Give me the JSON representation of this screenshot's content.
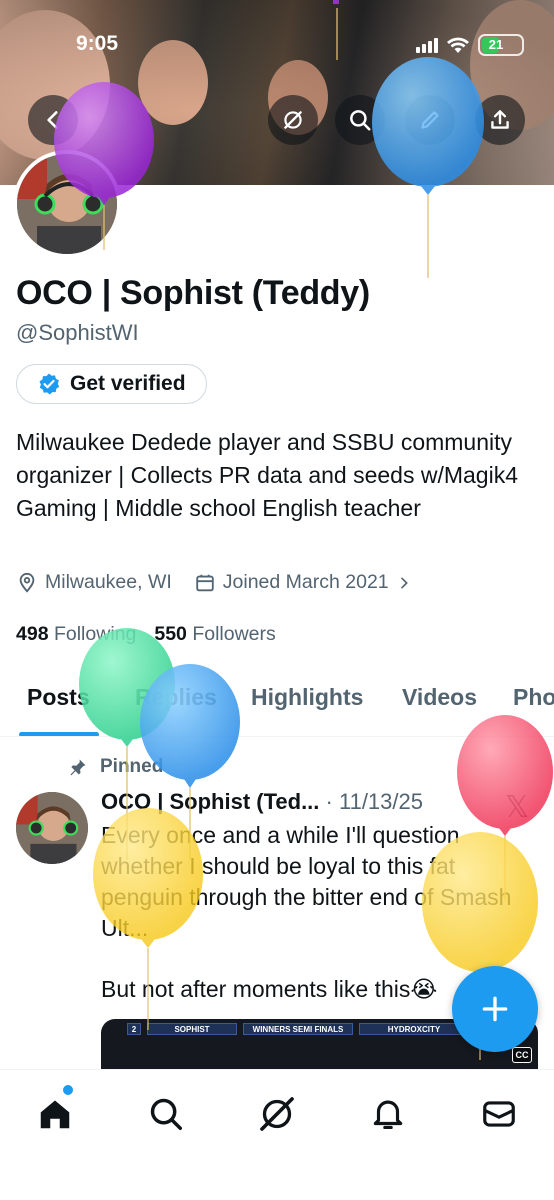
{
  "status_bar": {
    "time": "9:05",
    "battery": "21"
  },
  "header": {
    "back_icon": "back-arrow-icon",
    "grok_icon": "grok-icon",
    "search_icon": "search-icon",
    "edit_icon": "edit-pencil-icon",
    "share_icon": "share-upload-icon"
  },
  "profile": {
    "display_name": "OCO | Sophist (Teddy)",
    "handle": "@SophistWI",
    "verify_label": "Get verified",
    "bio": "Milwaukee Dedede player and SSBU community organizer | Collects PR data and seeds w/Magik4 Gaming | Middle school English teacher",
    "location": "Milwaukee, WI",
    "joined": "Joined March 2021",
    "following_count": "498",
    "following_label": "Following",
    "followers_count": "550",
    "followers_label": "Followers"
  },
  "tabs": [
    "Posts",
    "Replies",
    "Highlights",
    "Videos",
    "Photos"
  ],
  "post": {
    "pinned_label": "Pinned",
    "author": "OCO | Sophist (Ted...",
    "date": "· 11/13/25",
    "text": "Every once and a while I'll question whether I should be loyal to this fat penguin through the bitter end of Smash Ult...",
    "text2": "But not after moments like this",
    "emoji": "😭",
    "media": {
      "player1_port": "2",
      "player1": "SOPHIST",
      "round": "WINNERS SEMI FINALS",
      "player2": "HYDROXCITY",
      "cc": "CC"
    }
  },
  "colors": {
    "accent": "#1d9bf0",
    "text": "#0f1419",
    "muted": "#536471",
    "divider": "#eff3f4"
  },
  "bottom_nav": [
    "home-icon",
    "search-icon",
    "grok-icon",
    "notifications-bell-icon",
    "messages-mail-icon"
  ]
}
